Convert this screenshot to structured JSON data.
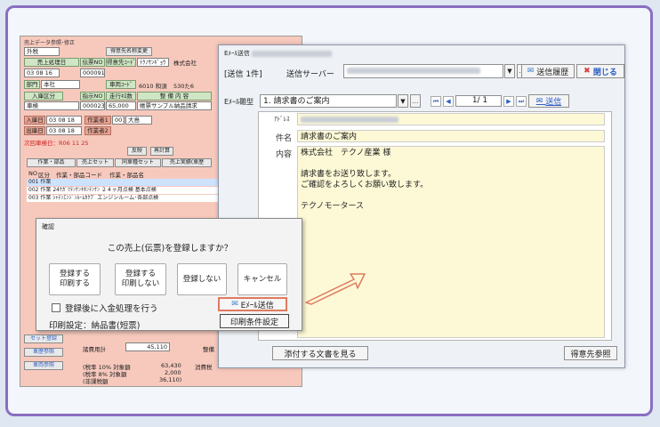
{
  "bg": {
    "title": "売上データ参照･修正",
    "tax_type": "外税",
    "labels": {
      "sales_date": "売上処理日",
      "slip_no": "伝票NO",
      "customer_change": "得意先名称変更",
      "customer_code": "得意先ｺｰﾄﾞ",
      "dept": "部門",
      "vehicle_code": "車両ｺｰﾄﾞ",
      "in_type": "入庫区分",
      "designated_no": "指示NO",
      "mileage": "走行ｷﾛ数",
      "maintenance": "整 備 内 容",
      "in_date": "入庫日",
      "out_date": "出庫日",
      "worker1": "作業者1",
      "worker2": "作業者2"
    },
    "values": {
      "date": "03 08 16",
      "slip": "000091",
      "customer_kana": "ﾃｸﾉｻﾝｷﾞｮｳ",
      "customer_name": "株式会社",
      "dept_value": "本社",
      "vehicle": "6010 和須",
      "plate": "530た6",
      "in_type_value": "車検",
      "designated": "000023",
      "mileage_value": "65,000",
      "maintenance_value": "帳票サンプル納品請求",
      "in_date_value": "03 08 18",
      "out_date_value": "03 08 18",
      "worker1_name": "大島",
      "worker1_code": "001",
      "next_date": "次回車検日：R06 11 25"
    },
    "buttons": {
      "recalc": "再計算",
      "reflect": "反映"
    },
    "tabs": [
      "作業・部品",
      "売上セット",
      "同車種セット",
      "売上実績(車歴"
    ],
    "table": {
      "headers": [
        "NO",
        "区分",
        "作業・部品コード",
        "作業・部品名"
      ],
      "rows": [
        [
          "001",
          "作業",
          "",
          ""
        ],
        [
          "002",
          "作業",
          "24ｹｶﾞﾂﾃﾝｹﾝｷﾎﾝﾃﾝｹﾝ",
          "２４ヶ月点検 基本点検"
        ],
        [
          "003",
          "作業",
          "ｼｬﾃﾝｴﾝｼﾞﾝﾙｰﾑｶｸﾌﾞ",
          "エンジンルーム･各部点検"
        ]
      ]
    },
    "left_buttons": [
      "セット登録",
      "車歴参照",
      "車両参照"
    ],
    "bottom": {
      "expense_label": "諸費用計",
      "expense_value": "45,110",
      "tax10_label": "(税率 10% 対象額",
      "tax10_value": "63,430",
      "tax8_label": "(税率 8% 対象額",
      "tax8_value": "2,000",
      "nontax_label": "(非課税額",
      "nontax_value": "36,110)",
      "consumption": "消費税",
      "maintenance_total": "整備"
    }
  },
  "confirm": {
    "title": "確認",
    "question": "この売上(伝票)を登録しますか？",
    "buttons": [
      "登録する\n印刷する",
      "登録する\n印刷しない",
      "登録しない",
      "キャンセル"
    ],
    "checkbox_label": "登録後に入金処理を行う",
    "print_setting": "印刷設定：納品書(短票)",
    "email_button": "Eﾒｰﾙ送信",
    "print_cond_button": "印刷条件設定"
  },
  "mail": {
    "title": "Eﾒｰﾙ送信",
    "count": "[送信 1件]",
    "server_label": "送信サーバー",
    "history_button": "送信履歴",
    "close_button": "閉じる",
    "template_label": "Eﾒｰﾙ雛型",
    "template_value": "1. 請求書のご案内",
    "page": "1/ 1",
    "send_button": "送信",
    "address_label": "ｱﾄﾞﾚｽ",
    "subject_label": "件名",
    "subject_value": "請求書のご案内",
    "body_label": "内容",
    "body_lines": [
      "株式会社　テクノ産業 様",
      "",
      "請求書をお送り致します。",
      "ご確認をよろしくお願い致します。",
      "",
      "テクノモータース"
    ],
    "attach_button": "添付する文書を見る",
    "customer_ref_button": "得意先参照"
  },
  "colors": {
    "accent": "#8a6fc0",
    "arrow": "#e07a5f",
    "close_red": "#d43a3a"
  }
}
